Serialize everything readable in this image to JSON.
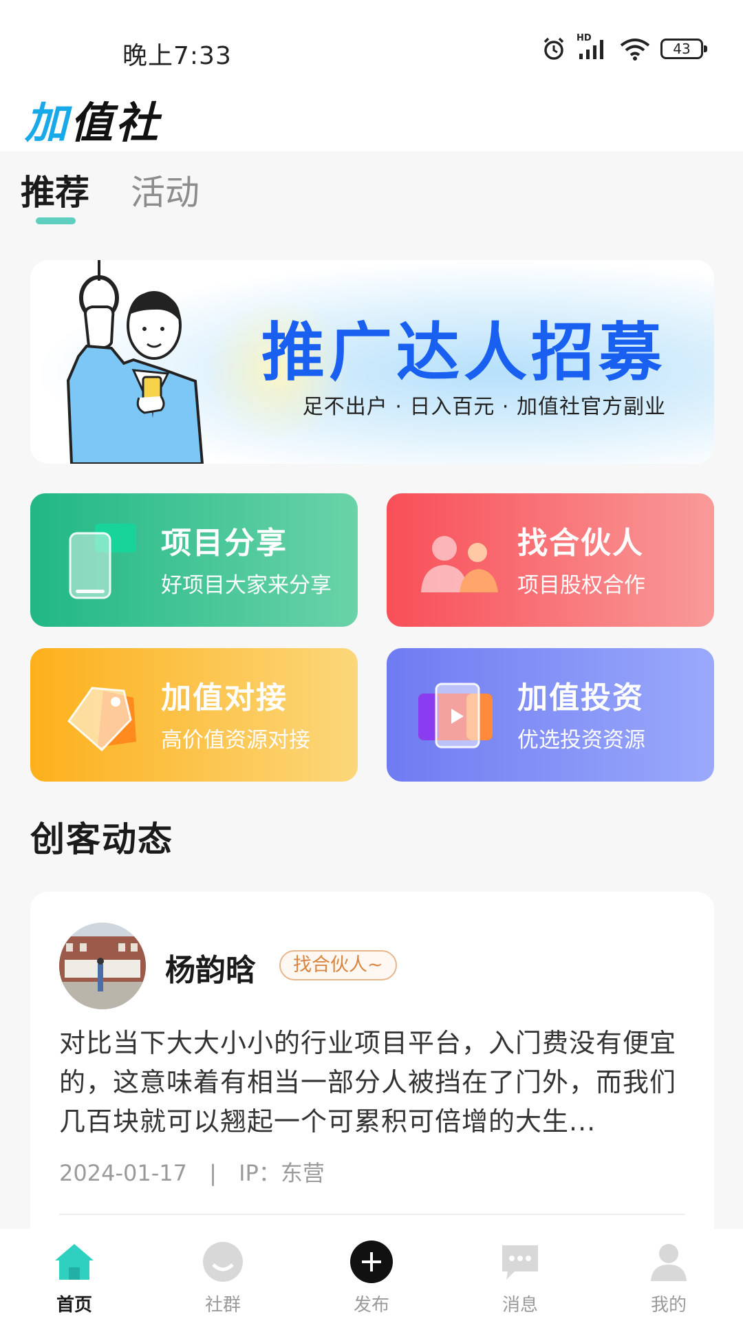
{
  "status": {
    "time": "晚上7:33",
    "battery": "43",
    "signal_badge": "HD"
  },
  "header": {
    "logo_text": "加值社",
    "logo_first_char": "加",
    "logo_rest": "值社"
  },
  "tabs": [
    {
      "label": "推荐",
      "active": true
    },
    {
      "label": "活动",
      "active": false
    }
  ],
  "banner": {
    "title": "推广达人招募",
    "subtitle": "足不出户 · 日入百元 · 加值社官方副业"
  },
  "features": [
    {
      "title": "项目分享",
      "subtitle": "好项目大家来分享",
      "icon": "phone-icon"
    },
    {
      "title": "找合伙人",
      "subtitle": "项目股权合作",
      "icon": "people-icon"
    },
    {
      "title": "加值对接",
      "subtitle": "高价值资源对接",
      "icon": "tag-icon"
    },
    {
      "title": "加值投资",
      "subtitle": "优选投资资源",
      "icon": "video-icon"
    }
  ],
  "section": {
    "title": "创客动态"
  },
  "post": {
    "author": "杨韵晗",
    "tag": "找合伙人~",
    "text": "对比当下大大小小的行业项目平台，入门费没有便宜的，这意味着有相当一部分人被挡在了门外，而我们几百块就可以翘起一个可累积可倍增的大生...",
    "date": "2024-01-17",
    "separator": "|",
    "ip": "IP：东营"
  },
  "bottom_nav": [
    {
      "label": "首页",
      "icon": "home-icon",
      "active": true
    },
    {
      "label": "社群",
      "icon": "community-icon",
      "active": false
    },
    {
      "label": "发布",
      "icon": "plus-icon",
      "active": false
    },
    {
      "label": "消息",
      "icon": "message-icon",
      "active": false
    },
    {
      "label": "我的",
      "icon": "profile-icon",
      "active": false
    }
  ],
  "colors": {
    "accent": "#5ecfbe",
    "banner_title": "#1960f0",
    "tag_text": "#d9853f"
  }
}
